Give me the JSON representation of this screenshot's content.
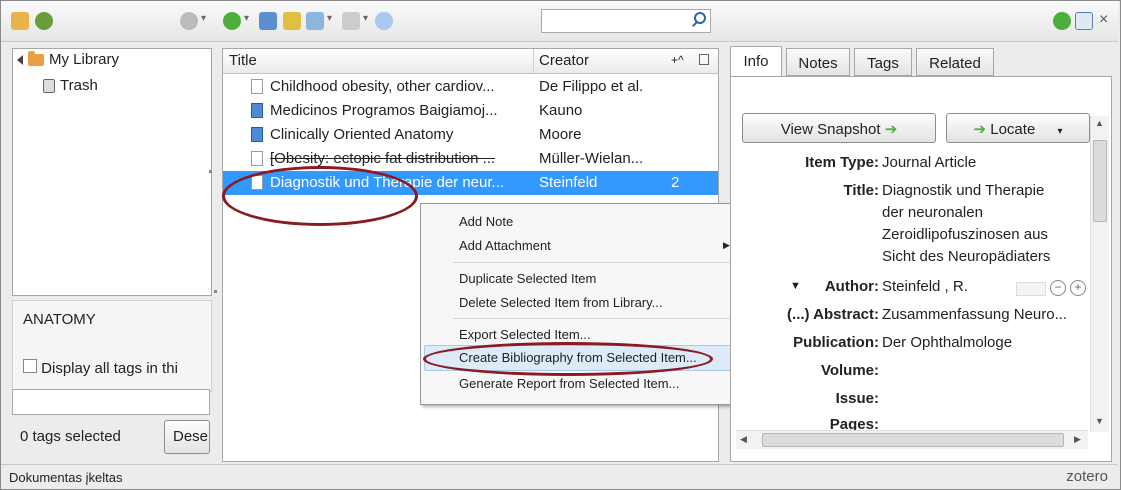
{
  "toolbar": {
    "icons": [
      "new-collection-icon",
      "new-group-icon",
      "actions-gear-icon",
      "new-item-icon",
      "add-by-identifier-icon",
      "new-note-icon",
      "add-attachment-icon",
      "advanced-search-icon",
      "sync-icon",
      "fullscreen-icon",
      "close-icon"
    ],
    "search": {
      "value": "",
      "placeholder": ""
    }
  },
  "library": {
    "root": "My Library",
    "trash": "Trash"
  },
  "tags": {
    "collection_label": "ANATOMY",
    "display_all_label": "Display all tags in thi",
    "filter_value": "",
    "selected_count": "0 tags selected",
    "deselect_label": "Dese"
  },
  "items": {
    "columns": {
      "title": "Title",
      "creator": "Creator",
      "extra": "+^"
    },
    "rows": [
      {
        "title": "Childhood obesity, other cardiov...",
        "creator": "De Filippo et al.",
        "icon": "document-icon",
        "count": ""
      },
      {
        "title": "Medicinos Programos Baigiamoj...",
        "creator": "Kauno",
        "icon": "book-icon",
        "count": ""
      },
      {
        "title": "Clinically Oriented Anatomy",
        "creator": "Moore",
        "icon": "book-icon",
        "count": ""
      },
      {
        "title": "[Obesity: ectopic fat distribution ...",
        "creator": "Müller-Wielan...",
        "icon": "document-icon",
        "count": ""
      },
      {
        "title": "Diagnostik und Therapie der neur...",
        "creator": "Steinfeld",
        "icon": "document-icon",
        "count": "2"
      }
    ]
  },
  "context_menu": {
    "add_note": "Add Note",
    "add_attachment": "Add Attachment",
    "duplicate": "Duplicate Selected Item",
    "delete": "Delete Selected Item from Library...",
    "export": "Export Selected Item...",
    "create_bibliography": "Create Bibliography from Selected Item...",
    "generate_report": "Generate Report from Selected Item..."
  },
  "tabs": [
    "Info",
    "Notes",
    "Tags",
    "Related"
  ],
  "info": {
    "view_snapshot": "View Snapshot",
    "locate": "Locate",
    "item_type_label": "Item Type:",
    "item_type": "Journal Article",
    "title_label": "Title:",
    "title_lines": [
      "Diagnostik und Therapie",
      "der neuronalen",
      "Zeroidlipofuszinosen aus",
      "Sicht des Neuropädiaters"
    ],
    "author_label": "Author:",
    "author": "Steinfeld  ,  R.",
    "abstract_label": "(...) Abstract:",
    "abstract": "Zusammenfassung  Neuro...",
    "publication_label": "Publication:",
    "publication": "Der Ophthalmologe",
    "volume_label": "Volume:",
    "issue_label": "Issue:",
    "pages_label": "Pages:"
  },
  "status": {
    "left": "Dokumentas įkeltas",
    "brand": "zotero"
  },
  "colors": {
    "selection": "#3399ff",
    "annotation": "#8b1a22"
  }
}
